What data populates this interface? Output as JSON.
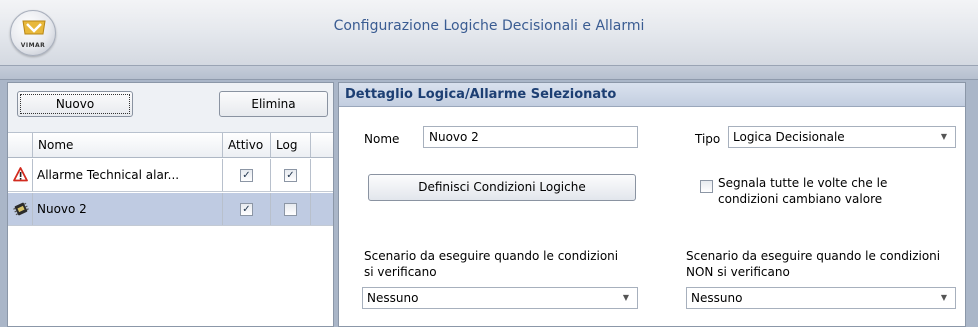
{
  "window": {
    "title": "Configurazione Logiche Decisionali e Allarmi",
    "logo_text": "VIMAR"
  },
  "toolbar": {
    "new_label": "Nuovo",
    "delete_label": "Elimina"
  },
  "grid": {
    "headers": {
      "name": "Nome",
      "active": "Attivo",
      "log": "Log"
    },
    "rows": [
      {
        "icon": "alarm-warning-icon",
        "name": "Allarme Technical alar...",
        "active": true,
        "log": true
      },
      {
        "icon": "logic-chip-icon",
        "name": "Nuovo 2",
        "active": true,
        "log": false
      }
    ]
  },
  "detail": {
    "header": "Dettaglio Logica/Allarme Selezionato",
    "name_label": "Nome",
    "name_value": "Nuovo 2",
    "type_label": "Tipo",
    "type_value": "Logica Decisionale",
    "define_button": "Definisci Condizioni Logiche",
    "signal_checkbox_line1": "Segnala tutte le volte che le",
    "signal_checkbox_line2": "condizioni cambiano valore",
    "signal_checked": false,
    "scenario_true_line1": "Scenario da eseguire quando le condizioni",
    "scenario_true_line2": "si verificano",
    "scenario_true_value": "Nessuno",
    "scenario_false_line1": "Scenario da eseguire quando le condizioni",
    "scenario_false_line2": "NON si verificano",
    "scenario_false_value": "Nessuno"
  },
  "colors": {
    "selected_row": "#bfcbe2",
    "header_text": "#1d3f73",
    "title_text": "#3a5c92",
    "alarm_red": "#d22b1f"
  }
}
